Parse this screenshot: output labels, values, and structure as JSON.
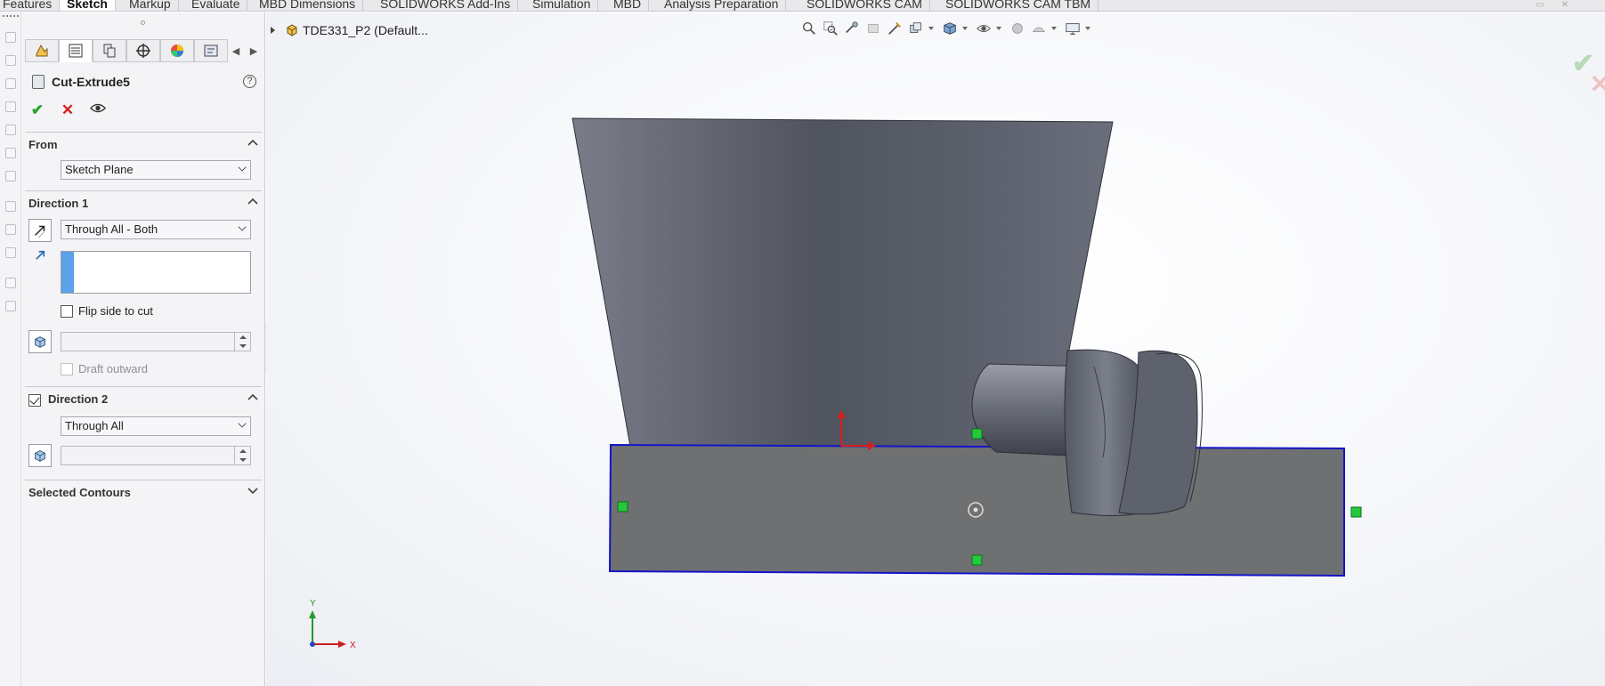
{
  "tabs": [
    {
      "label": "Features",
      "active": false
    },
    {
      "label": "Sketch",
      "active": true
    },
    {
      "label": "Markup",
      "active": false
    },
    {
      "label": "Evaluate",
      "active": false
    },
    {
      "label": "MBD Dimensions",
      "active": false
    },
    {
      "label": "SOLIDWORKS Add-Ins",
      "active": false
    },
    {
      "label": "Simulation",
      "active": false
    },
    {
      "label": "MBD",
      "active": false
    },
    {
      "label": "Analysis Preparation",
      "active": false
    },
    {
      "label": "SOLIDWORKS CAM",
      "active": false
    },
    {
      "label": "SOLIDWORKS CAM TBM",
      "active": false
    }
  ],
  "panel": {
    "feature_title": "Cut-Extrude5",
    "help_glyph": "?",
    "ok_glyph": "✔",
    "cancel_glyph": "✕",
    "from": {
      "label": "From",
      "value": "Sketch Plane"
    },
    "direction1": {
      "label": "Direction 1",
      "end_condition": "Through All - Both",
      "flip_side_label": "Flip side to cut",
      "flip_side_checked": false,
      "depth_value": "",
      "draft_outward_label": "Draft outward",
      "draft_outward_checked": false
    },
    "direction2": {
      "label": "Direction 2",
      "enabled": true,
      "end_condition": "Through All",
      "depth_value": ""
    },
    "selected_contours": {
      "label": "Selected Contours"
    }
  },
  "viewport": {
    "document_name": "TDE331_P2  (Default...",
    "triad_x": "X",
    "triad_y": "Y",
    "confirm_ok_glyph": "✔",
    "confirm_cancel_glyph": "✕"
  },
  "colors": {
    "sketch_line": "#1414c8",
    "part_body": "#5d606b",
    "face_fill": "#6f7072",
    "handle": "#22c93a",
    "ok_green": "#2ea12e",
    "cancel_red": "#d62020",
    "selection_blue": "#5aa2e9"
  }
}
